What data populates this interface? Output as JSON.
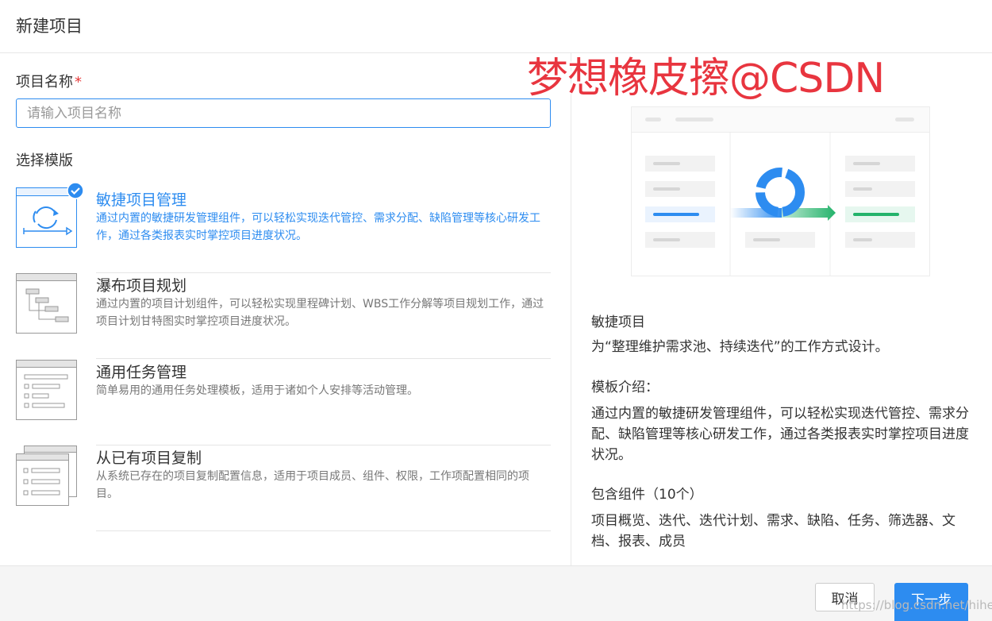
{
  "dialog": {
    "title": "新建项目"
  },
  "form": {
    "name_label": "项目名称",
    "required_mark": "*",
    "name_placeholder": "请输入项目名称",
    "template_label": "选择模版"
  },
  "templates": [
    {
      "title": "敏捷项目管理",
      "desc": "通过内置的敏捷研发管理组件，可以轻松实现迭代管控、需求分配、缺陷管理等核心研发工作，通过各类报表实时掌控项目进度状况。",
      "selected": true,
      "icon": "agile-cycle-icon"
    },
    {
      "title": "瀑布项目规划",
      "desc": "通过内置的项目计划组件，可以轻松实现里程碑计划、WBS工作分解等项目规划工作，通过项目计划甘特图实时掌控项目进度状况。",
      "selected": false,
      "icon": "gantt-icon"
    },
    {
      "title": "通用任务管理",
      "desc": "简单易用的通用任务处理模板，适用于诸如个人安排等活动管理。",
      "selected": false,
      "icon": "task-list-icon"
    },
    {
      "title": "从已有项目复制",
      "desc": "从系统已存在的项目复制配置信息，适用于项目成员、组件、权限，工作项配置相同的项目。",
      "selected": false,
      "icon": "copy-project-icon"
    }
  ],
  "detail": {
    "type_name": "敏捷项目",
    "type_desc": "为“整理维护需求池、持续迭代”的工作方式设计。",
    "intro_label": "模板介绍：",
    "intro_text": "通过内置的敏捷研发管理组件，可以轻松实现迭代管控、需求分配、缺陷管理等核心研发工作，通过各类报表实时掌控项目进度状况。",
    "components_label": "包含组件（10个）",
    "components_text": "项目概览、迭代、迭代计划、需求、缺陷、任务、筛选器、文档、报表、成员"
  },
  "footer": {
    "cancel_label": "取消",
    "next_label": "下一步"
  },
  "watermarks": {
    "top": "梦想橡皮擦@CSDN",
    "bottom": "https://blog.csdn.net/hihell"
  },
  "colors": {
    "primary": "#2d8cf0",
    "required": "#e63b3b",
    "watermark": "#e8353f",
    "success": "#24b36b"
  }
}
